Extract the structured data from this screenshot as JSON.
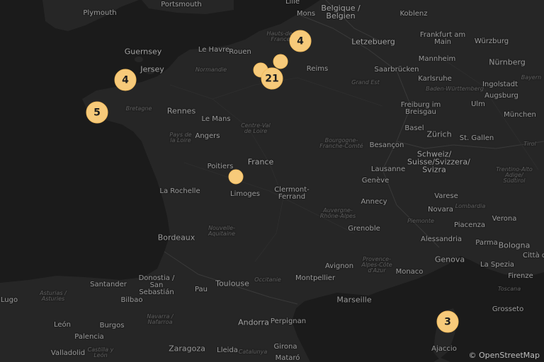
{
  "map": {
    "attribution": "© OpenStreetMap",
    "colors": {
      "land": "#262626",
      "sea": "#1b1b1b",
      "marker": "#f7ca7a",
      "marker_text": "#1e1e1e"
    },
    "labels": [
      {
        "text": "Plymouth",
        "kind": "city"
      },
      {
        "text": "Portsmouth",
        "kind": "city"
      },
      {
        "text": "Lille",
        "kind": "city"
      },
      {
        "text": "Mons",
        "kind": "city"
      },
      {
        "text": "Belgique / Belgien",
        "kind": "country"
      },
      {
        "text": "Koblenz",
        "kind": "city"
      },
      {
        "text": "Frankfurt am Main",
        "kind": "city"
      },
      {
        "text": "Letzebuerg",
        "kind": "country"
      },
      {
        "text": "Guernsey",
        "kind": "country"
      },
      {
        "text": "Jersey",
        "kind": "country"
      },
      {
        "text": "Le Havre",
        "kind": "city"
      },
      {
        "text": "Rouen",
        "kind": "city"
      },
      {
        "text": "Normandie",
        "kind": "region"
      },
      {
        "text": "Hauts-de-France",
        "kind": "region"
      },
      {
        "text": "Reims",
        "kind": "city"
      },
      {
        "text": "Mannheim",
        "kind": "city"
      },
      {
        "text": "Würzburg",
        "kind": "city"
      },
      {
        "text": "Nürnberg",
        "kind": "city"
      },
      {
        "text": "Saarbrücken",
        "kind": "city"
      },
      {
        "text": "Karlsruhe",
        "kind": "city"
      },
      {
        "text": "Grand Est",
        "kind": "region"
      },
      {
        "text": "Baden-Württemberg",
        "kind": "region"
      },
      {
        "text": "Bayern",
        "kind": "region"
      },
      {
        "text": "Ingolstadt",
        "kind": "city"
      },
      {
        "text": "Augsburg",
        "kind": "city"
      },
      {
        "text": "Ulm",
        "kind": "city"
      },
      {
        "text": "München",
        "kind": "city"
      },
      {
        "text": "Freiburg im Breisgau",
        "kind": "city"
      },
      {
        "text": "Rennes",
        "kind": "city"
      },
      {
        "text": "Bretagne",
        "kind": "region"
      },
      {
        "text": "Le Mans",
        "kind": "city"
      },
      {
        "text": "Angers",
        "kind": "city"
      },
      {
        "text": "Pays de la Loire",
        "kind": "region"
      },
      {
        "text": "Centre-Val de Loire",
        "kind": "region"
      },
      {
        "text": "France",
        "kind": "country"
      },
      {
        "text": "Bourgogne-Franche-Comté",
        "kind": "region"
      },
      {
        "text": "Besançon",
        "kind": "city"
      },
      {
        "text": "Basel",
        "kind": "city"
      },
      {
        "text": "Zürich",
        "kind": "city"
      },
      {
        "text": "St. Gallen",
        "kind": "city"
      },
      {
        "text": "Tirol",
        "kind": "region"
      },
      {
        "text": "Schweiz/ Suisse/Svizzera/ Svizra",
        "kind": "country"
      },
      {
        "text": "Lausanne",
        "kind": "city"
      },
      {
        "text": "Genève",
        "kind": "city"
      },
      {
        "text": "Poitiers",
        "kind": "city"
      },
      {
        "text": "Limoges",
        "kind": "city"
      },
      {
        "text": "La Rochelle",
        "kind": "city"
      },
      {
        "text": "Clermont-Ferrand",
        "kind": "city"
      },
      {
        "text": "Nouvelle-Aquitaine",
        "kind": "region"
      },
      {
        "text": "Auvergne-Rhône-Alpes",
        "kind": "region"
      },
      {
        "text": "Annecy",
        "kind": "city"
      },
      {
        "text": "Trentino-Alto Adige/ Südtirol",
        "kind": "region"
      },
      {
        "text": "Varese",
        "kind": "city"
      },
      {
        "text": "Lombardia",
        "kind": "region"
      },
      {
        "text": "Novara",
        "kind": "city"
      },
      {
        "text": "Verona",
        "kind": "city"
      },
      {
        "text": "Piacenza",
        "kind": "city"
      },
      {
        "text": "Piemonte",
        "kind": "region"
      },
      {
        "text": "Alessandria",
        "kind": "city"
      },
      {
        "text": "Parma",
        "kind": "city"
      },
      {
        "text": "Bologna",
        "kind": "city"
      },
      {
        "text": "Grenoble",
        "kind": "city"
      },
      {
        "text": "Bordeaux",
        "kind": "city"
      },
      {
        "text": "Avignon",
        "kind": "city"
      },
      {
        "text": "Monaco",
        "kind": "city"
      },
      {
        "text": "Genova",
        "kind": "city"
      },
      {
        "text": "Provence-Alpes-Côte d'Azur",
        "kind": "region"
      },
      {
        "text": "La Spezia",
        "kind": "city"
      },
      {
        "text": "Firenze",
        "kind": "city"
      },
      {
        "text": "Toscana",
        "kind": "region"
      },
      {
        "text": "Città di",
        "kind": "city"
      },
      {
        "text": "Toulouse",
        "kind": "city"
      },
      {
        "text": "Occitanie",
        "kind": "region"
      },
      {
        "text": "Montpellier",
        "kind": "city"
      },
      {
        "text": "Marseille",
        "kind": "city"
      },
      {
        "text": "Pau",
        "kind": "city"
      },
      {
        "text": "Santander",
        "kind": "city"
      },
      {
        "text": "Donostia / San Sebastián",
        "kind": "city"
      },
      {
        "text": "Asturias / Asturies",
        "kind": "region"
      },
      {
        "text": "Lugo",
        "kind": "city"
      },
      {
        "text": "Bilbao",
        "kind": "city"
      },
      {
        "text": "Andorra",
        "kind": "country"
      },
      {
        "text": "Perpignan",
        "kind": "city"
      },
      {
        "text": "León",
        "kind": "city"
      },
      {
        "text": "Burgos",
        "kind": "city"
      },
      {
        "text": "Navarra / Nafarroa",
        "kind": "region"
      },
      {
        "text": "Palencia",
        "kind": "city"
      },
      {
        "text": "Grosseto",
        "kind": "city"
      },
      {
        "text": "Girona",
        "kind": "city"
      },
      {
        "text": "Zaragoza",
        "kind": "city"
      },
      {
        "text": "Lleida",
        "kind": "city"
      },
      {
        "text": "Catalunya",
        "kind": "region"
      },
      {
        "text": "Valladolid",
        "kind": "city"
      },
      {
        "text": "Castilla y León",
        "kind": "region"
      },
      {
        "text": "Mataró",
        "kind": "city"
      },
      {
        "text": "Ajaccio",
        "kind": "city"
      }
    ],
    "markers": [
      {
        "name": "marker-cluster-northeast",
        "label": "4"
      },
      {
        "name": "marker-paris-west",
        "label": ""
      },
      {
        "name": "marker-paris-east",
        "label": ""
      },
      {
        "name": "marker-cluster-paris",
        "label": "21"
      },
      {
        "name": "marker-cluster-jersey",
        "label": "4"
      },
      {
        "name": "marker-cluster-brittany",
        "label": "5"
      },
      {
        "name": "marker-limoges",
        "label": ""
      },
      {
        "name": "marker-cluster-corsica",
        "label": "3"
      }
    ]
  }
}
